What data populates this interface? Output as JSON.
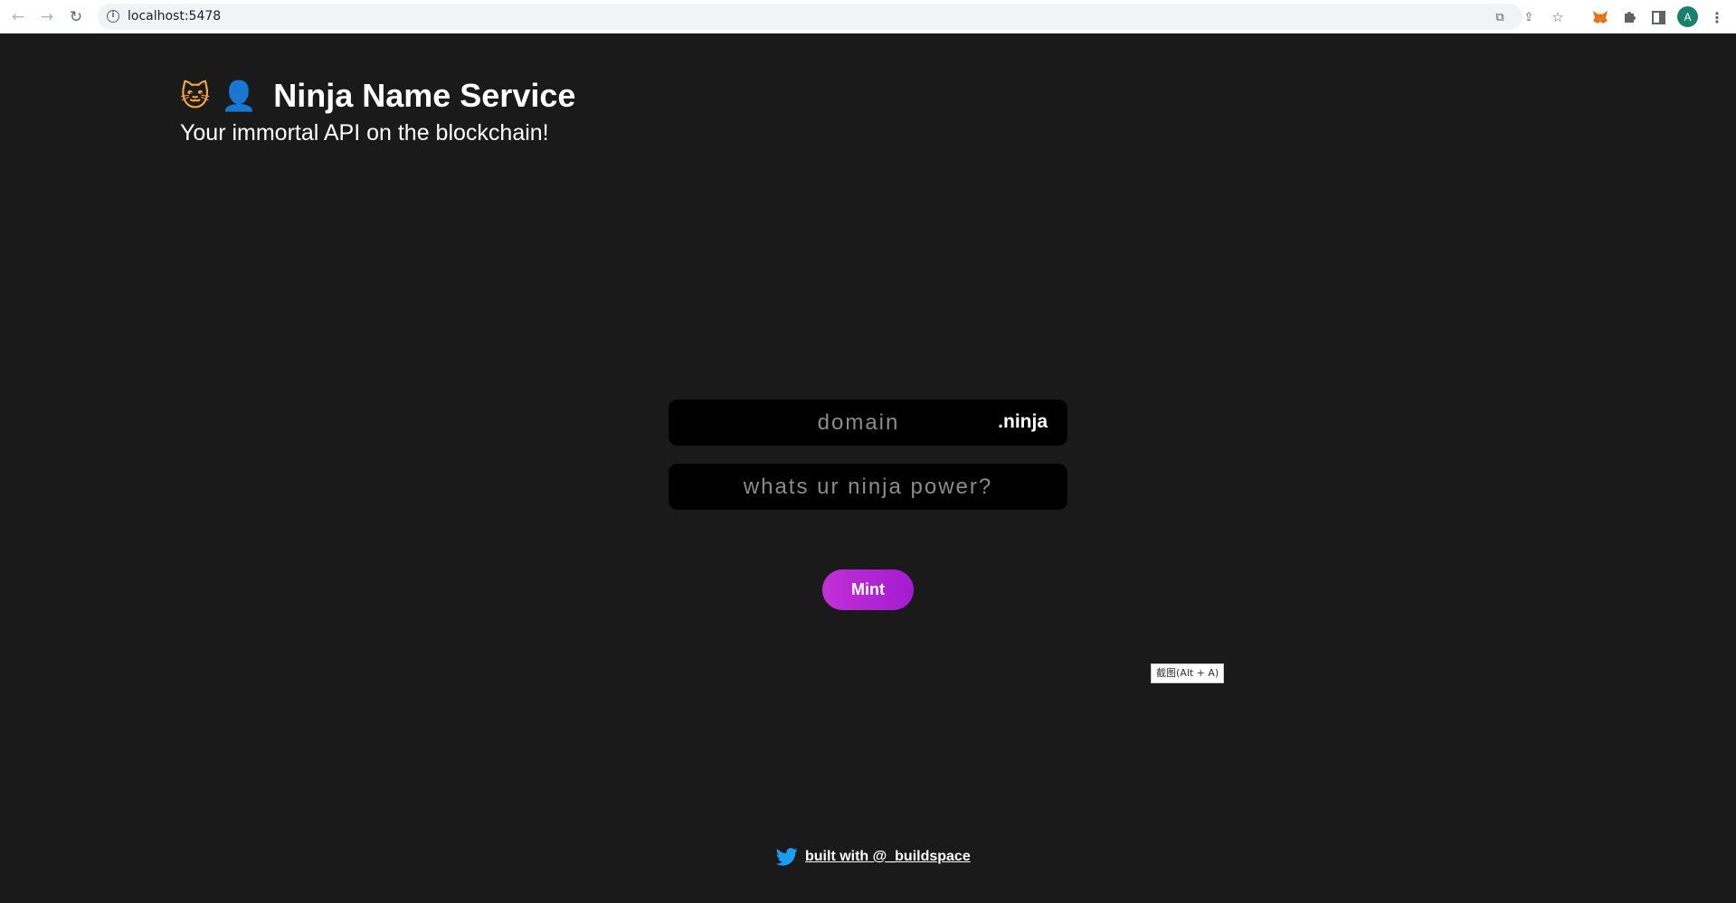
{
  "browser": {
    "url": "localhost:5478",
    "avatar_letter": "A",
    "icons": [
      "back-arrow-icon",
      "forward-arrow-icon",
      "reload-icon",
      "info-icon",
      "translate-icon",
      "share-icon",
      "star-icon",
      "metamask-fox-icon",
      "puzzle-icon",
      "side-panel-icon",
      "kebab-menu-icon"
    ]
  },
  "header": {
    "emoji_cat": "🐱",
    "emoji_ninja": "👤",
    "title": "Ninja Name Service",
    "subtitle": "Your immortal API on the blockchain!"
  },
  "form": {
    "domain_placeholder": "domain",
    "domain_value": "",
    "tld": ".ninja",
    "power_placeholder": "whats ur ninja power?",
    "power_value": "",
    "mint_label": "Mint"
  },
  "tooltip": "截图(Alt + A)",
  "footer": {
    "link_text": "built with @_buildspace"
  },
  "colors": {
    "page_bg": "#1a1a1b",
    "input_bg": "#000000",
    "mint_gradient_start": "#c22fd6",
    "mint_gradient_end": "#a21cd0",
    "twitter_blue": "#1d9bf0",
    "avatar_bg": "#1a7f6e"
  }
}
